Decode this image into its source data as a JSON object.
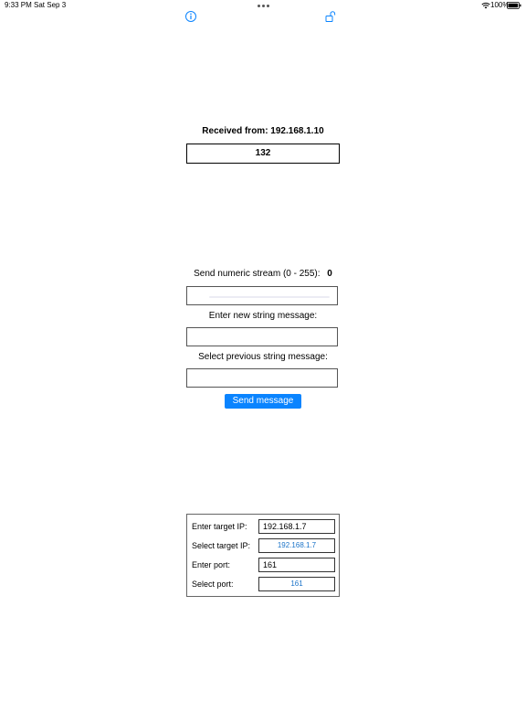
{
  "status_bar": {
    "time": "9:33 PM",
    "date": "Sat Sep 3",
    "battery": "100%"
  },
  "toolbar": {
    "info_icon": "info-circle-icon",
    "lock_icon": "unlocked-padlock-icon"
  },
  "received": {
    "title": "Received from: 192.168.1.10",
    "value": "132"
  },
  "send": {
    "numeric_label": "Send numeric stream (0 - 255):",
    "numeric_value": "0",
    "string_label": "Enter new string message:",
    "previous_label": "Select previous string message:",
    "send_button": "Send message"
  },
  "settings": {
    "target_ip_label": "Enter target IP:",
    "target_ip_value": "192.168.1.7",
    "select_ip_label": "Select target IP:",
    "select_ip_value": "192.168.1.7",
    "port_label": "Enter port:",
    "port_value": "161",
    "select_port_label": "Select port:",
    "select_port_value": "161"
  },
  "colors": {
    "accent": "#0a84ff",
    "link": "#1a73c8"
  }
}
